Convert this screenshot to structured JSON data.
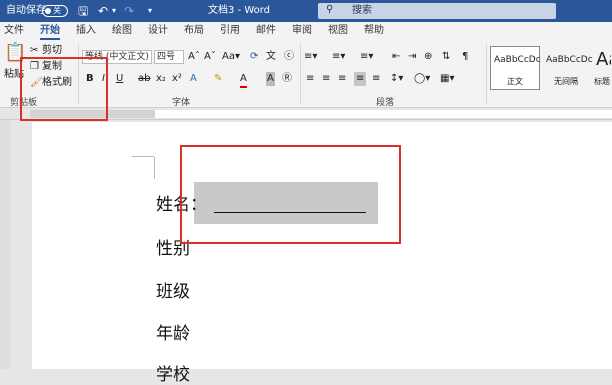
{
  "titlebar": {
    "autosave_label": "自动保存",
    "autosave_state": "关",
    "doc_title": "文档3 - Word",
    "search_placeholder": "搜索"
  },
  "menu_tabs": [
    "文件",
    "开始",
    "插入",
    "绘图",
    "设计",
    "布局",
    "引用",
    "邮件",
    "审阅",
    "视图",
    "帮助"
  ],
  "active_tab": "开始",
  "clipboard": {
    "paste_label": "粘贴",
    "cut_label": "剪切",
    "copy_label": "复制",
    "format_painter_label": "格式刷",
    "group_label": "剪贴板"
  },
  "font": {
    "font_name": "等线 (中文正文)",
    "font_size": "四号",
    "group_label": "字体"
  },
  "paragraph": {
    "group_label": "段落"
  },
  "styles": {
    "items": [
      {
        "sample": "AaBbCcDc",
        "name": "正文"
      },
      {
        "sample": "AaBbCcDc",
        "name": "无间隔"
      },
      {
        "sample": "Aa",
        "name": "标题"
      }
    ]
  },
  "document": {
    "lines": [
      "姓名：",
      "性别",
      "班级",
      "年龄",
      "学校"
    ]
  },
  "colors": {
    "accent": "#2b579a",
    "annotation": "#d9302c"
  }
}
